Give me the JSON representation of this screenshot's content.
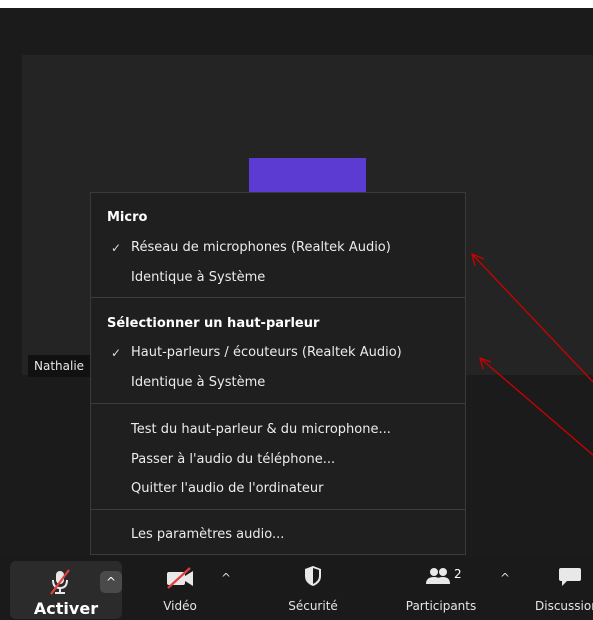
{
  "participant": {
    "name": "Nathalie"
  },
  "audio_menu": {
    "microphone_section": {
      "title": "Micro",
      "options": [
        {
          "label": "Réseau de microphones (Realtek Audio)",
          "selected": true
        },
        {
          "label": "Identique à Système",
          "selected": false
        }
      ]
    },
    "speaker_section": {
      "title": "Sélectionner un haut-parleur",
      "options": [
        {
          "label": "Haut-parleurs / écouteurs (Realtek Audio)",
          "selected": true
        },
        {
          "label": "Identique à Système",
          "selected": false
        }
      ]
    },
    "actions": [
      "Test du haut-parleur & du microphone...",
      "Passer à l'audio du téléphone...",
      "Quitter l'audio de l'ordinateur"
    ],
    "settings": "Les paramètres audio...",
    "check_glyph": "✓"
  },
  "toolbar": {
    "mic_label": "Activer",
    "video_label": "Vidéo",
    "security_label": "Sécurité",
    "participants_label": "Participants",
    "participants_count": "2",
    "chat_label": "Discussion",
    "caret": "^"
  },
  "colors": {
    "avatar": "#5b3bd1",
    "annotation_arrow": "#cc0000",
    "mute_slash": "#e04040"
  }
}
